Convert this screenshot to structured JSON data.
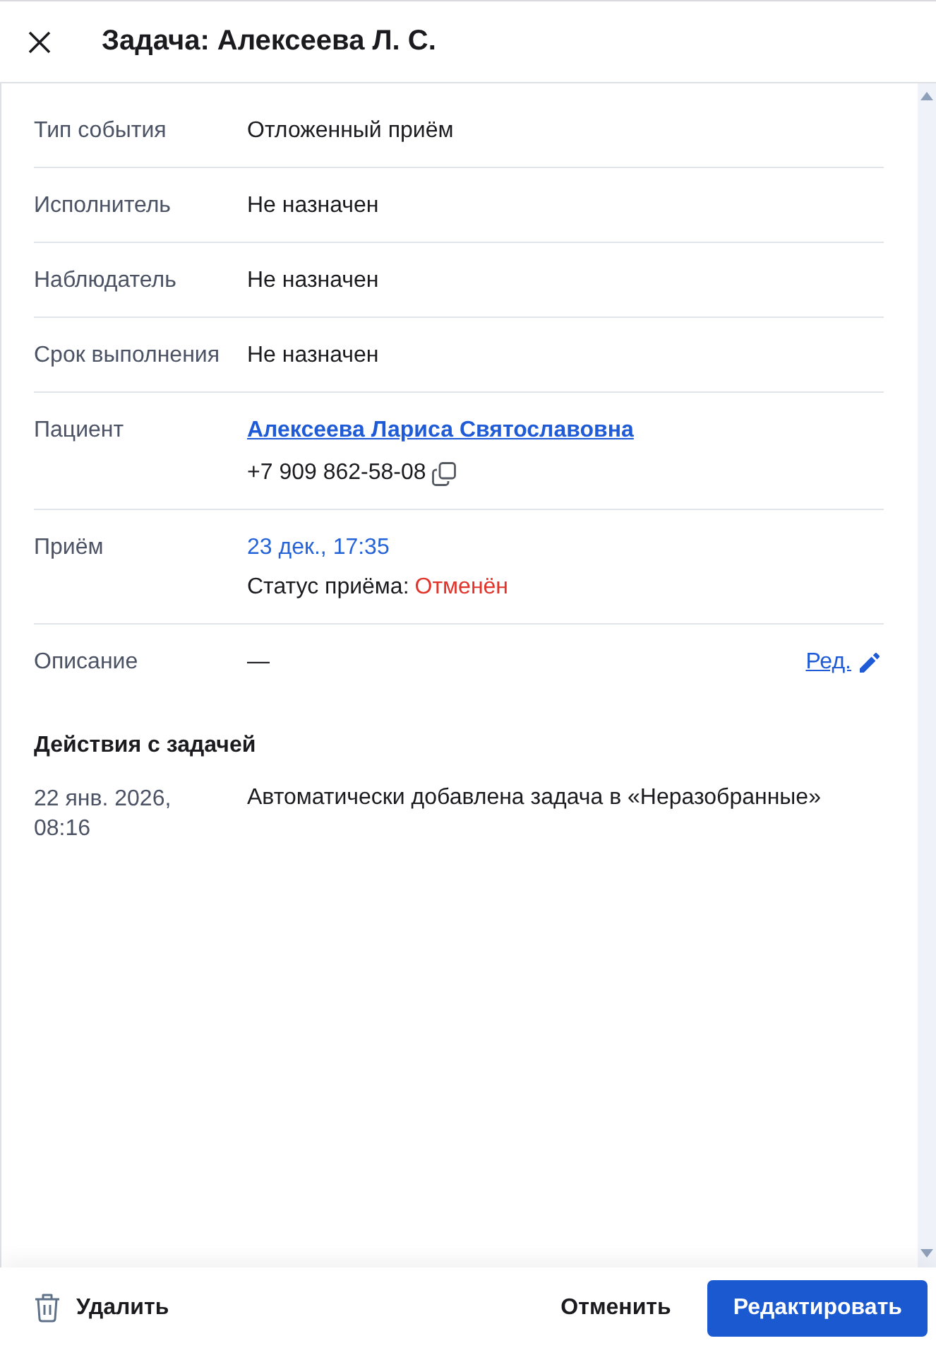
{
  "header": {
    "title": "Задача: Алексеева Л. С."
  },
  "fields": [
    {
      "kind": "text",
      "label": "Тип события",
      "value": "Отложенный приём"
    },
    {
      "kind": "text",
      "label": "Исполнитель",
      "value": "Не назначен"
    },
    {
      "kind": "text",
      "label": "Наблюдатель",
      "value": "Не назначен"
    },
    {
      "kind": "text",
      "label": "Срок выполнения",
      "value": "Не назначен"
    },
    {
      "kind": "patient",
      "label": "Пациент",
      "name": "Алексеева Лариса Святославовна",
      "phone": "+7 909 862-58-08"
    },
    {
      "kind": "appointment",
      "label": "Приём",
      "datetime": "23 дек., 17:35",
      "status_label": "Статус приёма:",
      "status": "Отменён"
    },
    {
      "kind": "description",
      "label": "Описание",
      "value": "—",
      "edit_link": "Ред."
    }
  ],
  "actions": {
    "title": "Действия с задачей",
    "entries": [
      {
        "date": "22 янв. 2026, 08:16",
        "text": "Автоматически добавлена задача в «Неразобранные»"
      }
    ]
  },
  "footer": {
    "delete": "Удалить",
    "cancel": "Отменить",
    "edit": "Редактировать"
  }
}
